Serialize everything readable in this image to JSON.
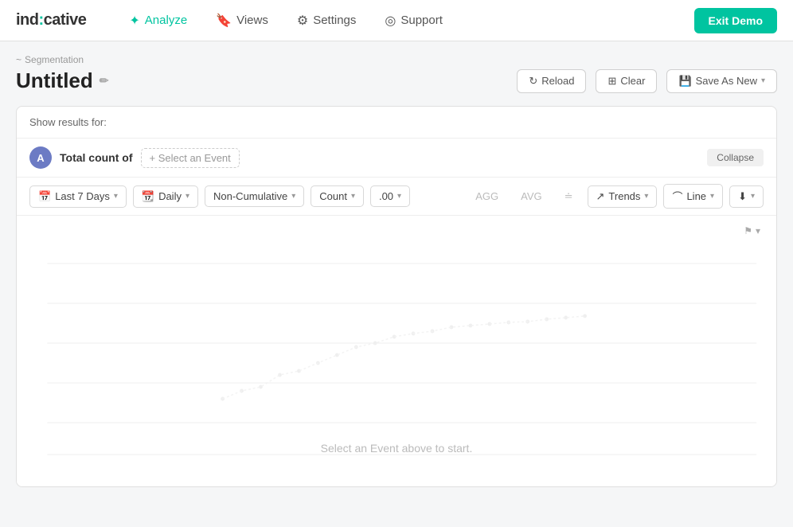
{
  "app": {
    "logo_text": "ind:cative"
  },
  "nav": {
    "items": [
      {
        "id": "analyze",
        "label": "Analyze",
        "icon": "⚙",
        "active": true
      },
      {
        "id": "views",
        "label": "Views",
        "icon": "🔖"
      },
      {
        "id": "settings",
        "label": "Settings",
        "icon": "⚙"
      },
      {
        "id": "support",
        "label": "Support",
        "icon": "🛟"
      }
    ],
    "exit_label": "Exit Demo"
  },
  "breadcrumb": {
    "icon": "~",
    "text": "Segmentation"
  },
  "page": {
    "title": "Untitled",
    "edit_icon": "✏"
  },
  "header_actions": {
    "reload_label": "Reload",
    "clear_label": "Clear",
    "save_as_label": "Save As New"
  },
  "show_results": {
    "label": "Show results for:"
  },
  "row_a": {
    "avatar": "A",
    "total_count_label": "Total count of",
    "select_event_placeholder": "+ Select an Event",
    "collapse_label": "Collapse"
  },
  "controls": {
    "date_range": "Last 7 Days",
    "frequency": "Daily",
    "cumulative": "Non-Cumulative",
    "count": "Count",
    "decimal": ".00",
    "agg": "AGG",
    "avg": "AVG",
    "trends_label": "Trends",
    "line_label": "Line"
  },
  "chart": {
    "empty_text": "Select an Event above to start."
  }
}
